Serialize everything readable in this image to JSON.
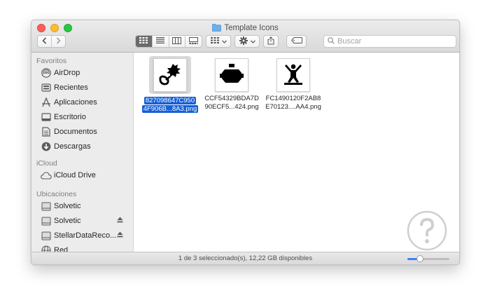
{
  "window": {
    "title": "Template Icons",
    "search_placeholder": "Buscar"
  },
  "sidebar": {
    "sections": [
      {
        "title": "Favoritos",
        "items": [
          {
            "label": "AirDrop",
            "icon": "airdrop-icon"
          },
          {
            "label": "Recientes",
            "icon": "recents-icon"
          },
          {
            "label": "Aplicaciones",
            "icon": "applications-icon"
          },
          {
            "label": "Escritorio",
            "icon": "desktop-icon"
          },
          {
            "label": "Documentos",
            "icon": "documents-icon"
          },
          {
            "label": "Descargas",
            "icon": "downloads-icon"
          }
        ]
      },
      {
        "title": "iCloud",
        "items": [
          {
            "label": "iCloud Drive",
            "icon": "cloud-icon"
          }
        ]
      },
      {
        "title": "Ubicaciones",
        "items": [
          {
            "label": "Solvetic",
            "icon": "drive-icon"
          },
          {
            "label": "Solvetic",
            "icon": "drive-icon",
            "eject": true
          },
          {
            "label": "StellarDataReco...",
            "icon": "drive-icon",
            "eject": true
          },
          {
            "label": "Red",
            "icon": "network-icon"
          }
        ]
      }
    ]
  },
  "files": [
    {
      "name_line1": "827098647C950",
      "name_line2": "4F906B...8A3.png",
      "selected": true,
      "icon": "tree-hand-icon"
    },
    {
      "name_line1": "CCF54329BDA7D",
      "name_line2": "90ECF5...424.png",
      "selected": false,
      "icon": "engine-icon"
    },
    {
      "name_line1": "FC1490120F2AB8",
      "name_line2": "E70123....AA4.png",
      "selected": false,
      "icon": "person-icon"
    }
  ],
  "status": {
    "text": "1 de 3 seleccionado(s), 12,22 GB disponibles",
    "icon_size_level": 0.25
  },
  "colors": {
    "selection": "#1460d8",
    "accent": "#3b82f6",
    "folder": "#5fa8e6"
  }
}
